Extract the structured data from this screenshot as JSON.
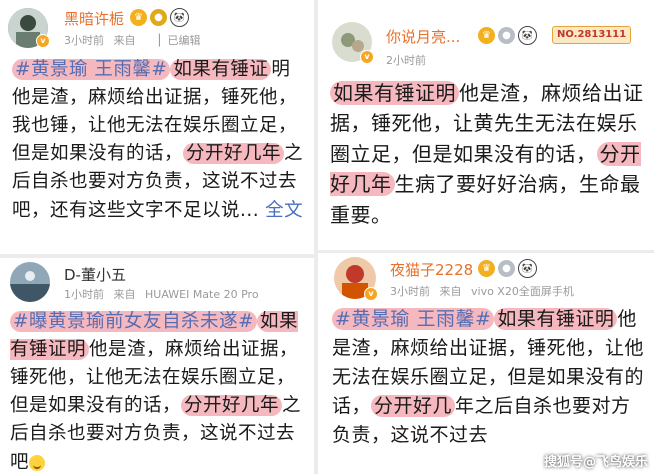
{
  "posts": [
    {
      "username": "黑暗许栀",
      "time": "3小时前",
      "source": "来自",
      "edited": "已编辑",
      "badge_icons": [
        "level-badge",
        "gold-medal-badge",
        "panda-badge"
      ],
      "text": {
        "tag": "#黄景瑜 王雨馨#",
        "hl1": "如果有锤证",
        "p1": "明他是渣，麻烦给出证据，锤死他，我也锤，让他无法在娱乐圈立足，但是如果没有的话，",
        "hl2": "分开好几年",
        "p2": "之后自杀也要对方负责，这说不过去吧，还有这些文字不足以说...",
        "more": "全文"
      }
    },
    {
      "username": "你说月亮...",
      "time": "2小时前",
      "badge_icons": [
        "level-badge",
        "silver-medal-badge",
        "panda-badge"
      ],
      "number_badge": "NO.2813111",
      "text": {
        "hl1": "如果有锤证明",
        "p1": "他是渣，麻烦给出证据，锤死他，让黄先生无法在娱乐圈立足，但是如果没有的话，",
        "hl2": "分开好几年",
        "p2": "生病了要好好治病，生命最重要。"
      }
    },
    {
      "username": "D-董小五",
      "time": "1小时前",
      "source": "来自",
      "device": "HUAWEI Mate 20 Pro",
      "text": {
        "tag": "#曝黄景瑜前女友自杀未遂#",
        "hl1": "如果有锤证明",
        "p1": "他是渣，麻烦给出证据，锤死他，让他无法在娱乐圈立足，但是如果没有的话，",
        "hl2": "分开好几年",
        "p2": "之后自杀也要对方负责，这说不过去吧"
      }
    },
    {
      "username": "夜猫子2228",
      "time": "3小时前",
      "source": "来自",
      "device": "vivo X20全面屏手机",
      "badge_icons": [
        "level-badge",
        "silver-medal-badge",
        "panda-badge"
      ],
      "text": {
        "tag": "#黄景瑜 王雨馨#",
        "hl1": "如果有锤证明",
        "p1": "他是渣，麻烦给出证据，锤死他，让他无法在娱乐圈立足，但是如果没有的话，",
        "hl2": "分开好几",
        "p2": "年之后自杀也要对方负责，这说不过去"
      }
    }
  ],
  "watermark": "搜狐号@飞鸟娱乐",
  "colors": {
    "username": "#e8702a",
    "topic": "#556db3",
    "highlight": "#f6b8bf",
    "meta": "#9a9a9a"
  }
}
